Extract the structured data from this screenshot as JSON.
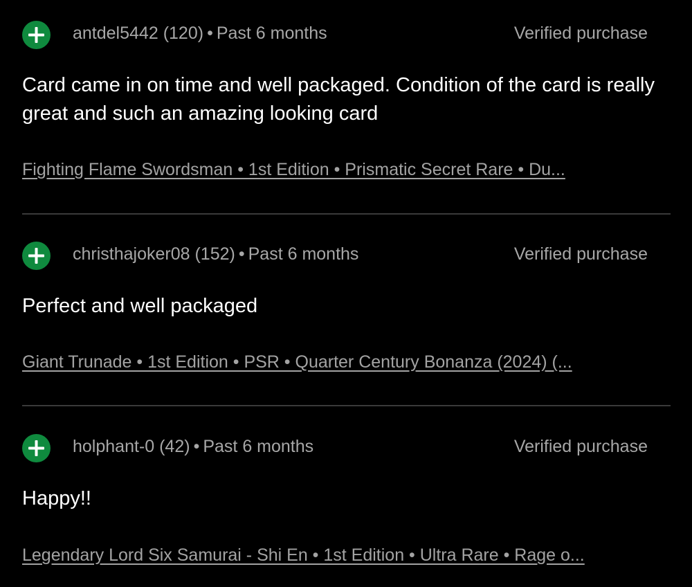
{
  "colors": {
    "background": "#000000",
    "accent_green": "#0f8a3e",
    "meta_text": "#a7a7a7",
    "body_text": "#ffffff",
    "divider": "#3a3a3a"
  },
  "icons": {
    "feedback": "plus-icon"
  },
  "reviews": [
    {
      "username": "antdel5442",
      "score": "(120)",
      "separator": "•",
      "time": "Past 6 months",
      "verified": "Verified purchase",
      "text": "Card came in on time and well packaged. Condition of the card is really great and such an amazing looking card",
      "item": "Fighting Flame Swordsman • 1st Edition • Prismatic Secret Rare • Du..."
    },
    {
      "username": "christhajoker08",
      "score": "(152)",
      "separator": "•",
      "time": "Past 6 months",
      "verified": "Verified purchase",
      "text": "Perfect and well packaged",
      "item": "Giant Trunade • 1st Edition • PSR • Quarter Century Bonanza (2024) (..."
    },
    {
      "username": "holphant-0",
      "score": "(42)",
      "separator": "•",
      "time": "Past 6 months",
      "verified": "Verified purchase",
      "text": "Happy!!",
      "item": "Legendary Lord Six Samurai - Shi En • 1st Edition • Ultra Rare • Rage o..."
    }
  ]
}
